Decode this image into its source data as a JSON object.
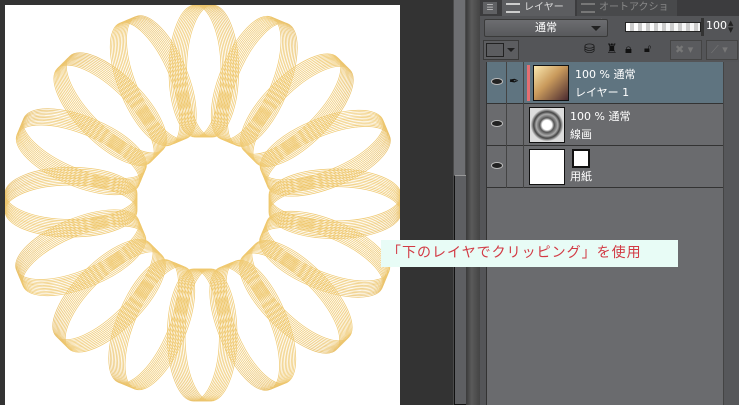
{
  "panel": {
    "tabs": [
      {
        "label": "レイヤー",
        "active": true
      },
      {
        "label": "オートアクション",
        "active": false
      }
    ],
    "blend_mode": "通常",
    "opacity": "100",
    "layers": [
      {
        "opacity_mode": "100 % 通常",
        "name": "レイヤー 1",
        "selected": true,
        "clipping": true
      },
      {
        "opacity_mode": "100 % 通常",
        "name": "線画",
        "selected": false
      },
      {
        "opacity_mode": "",
        "name": "用紙",
        "selected": false
      }
    ]
  },
  "annotation": "「下のレイヤでクリッピング」を使用",
  "colors": {
    "gold": "#e9c36e",
    "brown": "#5e3436",
    "selected_row": "#5f7480",
    "clip_bar": "#e46f72",
    "note_text": "#d23a44"
  }
}
